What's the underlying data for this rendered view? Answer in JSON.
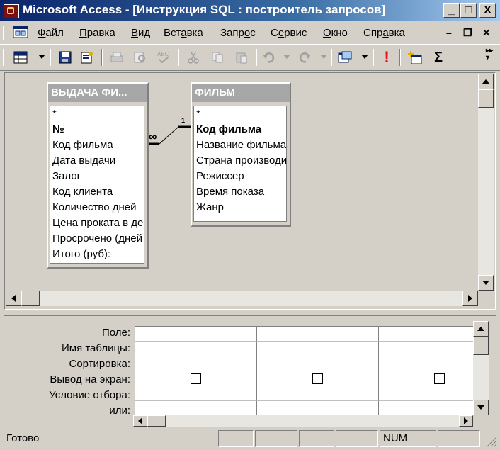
{
  "window": {
    "title": "Microsoft Access - [Инструкция SQL : построитель запросов]",
    "caption_buttons": [
      "_",
      "□",
      "X"
    ]
  },
  "menu": {
    "items": [
      {
        "underline": "Ф",
        "rest": "айл"
      },
      {
        "underline": "П",
        "rest": "равка"
      },
      {
        "underline": "В",
        "rest": "ид"
      },
      {
        "underline": "",
        "pre": "Вст",
        "mid": "а",
        "rest": "вка"
      },
      {
        "underline": "",
        "pre": "Запр",
        "mid": "о",
        "rest": "с"
      },
      {
        "underline": "",
        "pre": "С",
        "mid": "е",
        "rest": "рвис"
      },
      {
        "underline": "О",
        "rest": "кно"
      },
      {
        "underline": "",
        "pre": "Спр",
        "mid": "а",
        "rest": "вка"
      }
    ],
    "mdi_buttons": [
      "–",
      "❐",
      "✕"
    ]
  },
  "toolbar": {
    "icons": [
      "view-icon",
      "save-icon",
      "properties-icon",
      "print-icon",
      "preview-icon",
      "spelling-icon",
      "cut-icon",
      "copy-icon",
      "paste-icon",
      "undo-icon",
      "redo-icon",
      "query-type-icon",
      "run-icon",
      "show-table-icon",
      "totals-icon"
    ],
    "totals_glyph": "Σ",
    "run_glyph": "!"
  },
  "tables": [
    {
      "name": "ВЫДАЧА ФИ...",
      "fields": [
        {
          "text": "*",
          "key": false
        },
        {
          "text": "№",
          "key": true
        },
        {
          "text": "Код фильма",
          "key": false
        },
        {
          "text": "Дата выдачи",
          "key": false
        },
        {
          "text": "Залог",
          "key": false
        },
        {
          "text": "Код клиента",
          "key": false
        },
        {
          "text": "Количество дней",
          "key": false
        },
        {
          "text": "Цена проката в де",
          "key": false
        },
        {
          "text": "Просрочено (дней",
          "key": false
        },
        {
          "text": "Итого (руб):",
          "key": false
        }
      ]
    },
    {
      "name": "ФИЛЬМ",
      "fields": [
        {
          "text": "*",
          "key": false
        },
        {
          "text": "Код фильма",
          "key": true
        },
        {
          "text": "Название фильма",
          "key": false
        },
        {
          "text": "Страна производи",
          "key": false
        },
        {
          "text": "Режиссер",
          "key": false
        },
        {
          "text": "Время показа",
          "key": false
        },
        {
          "text": "Жанр",
          "key": false
        }
      ]
    }
  ],
  "relationship": {
    "many_symbol": "∞",
    "one_symbol": "1"
  },
  "grid": {
    "row_labels": [
      "Поле:",
      "Имя таблицы:",
      "Сортировка:",
      "Вывод на экран:",
      "Условие отбора:",
      "или:"
    ],
    "column_count": 3,
    "show_checked": [
      false,
      false,
      false
    ]
  },
  "status": {
    "text": "Готово",
    "num": "NUM"
  },
  "colors": {
    "title_gradient_start": "#0a246a",
    "title_gradient_end": "#a6caf0",
    "face": "#d4d0c8",
    "table_header": "#a7a7a7"
  }
}
